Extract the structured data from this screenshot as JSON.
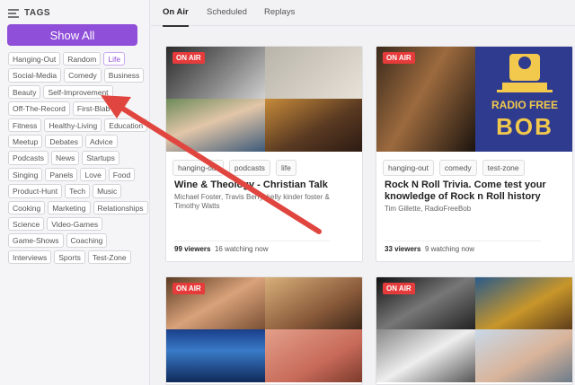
{
  "sidebar": {
    "header": "TAGS",
    "show_all": "Show All",
    "tags": [
      "Hanging-Out",
      "Random",
      "Life",
      "Social-Media",
      "Comedy",
      "Business",
      "Beauty",
      "Self-Improvement",
      "Off-The-Record",
      "First-Blab",
      "Fitness",
      "Healthy-Living",
      "Education",
      "Meetup",
      "Debates",
      "Advice",
      "Podcasts",
      "News",
      "Startups",
      "Singing",
      "Panels",
      "Love",
      "Food",
      "Product-Hunt",
      "Tech",
      "Music",
      "Cooking",
      "Marketing",
      "Relationships",
      "Science",
      "Video-Games",
      "Game-Shows",
      "Coaching",
      "Interviews",
      "Sports",
      "Test-Zone"
    ],
    "active_tag": "Life"
  },
  "tabs": [
    "On Air",
    "Scheduled",
    "Replays"
  ],
  "badge": "ON AIR",
  "cards": [
    {
      "chips": [
        "hanging-out",
        "podcasts",
        "life"
      ],
      "title": "Wine & Theology - Christian Talk",
      "desc": "Michael Foster, Travis Berry, kelly kinder foster & Timothy Watts",
      "viewers": "99 viewers",
      "watching": "16 watching now"
    },
    {
      "chips": [
        "hanging-out",
        "comedy",
        "test-zone"
      ],
      "title": "Rock N Roll Trivia. Come test your knowledge of Rock n Roll history",
      "desc": "Tim Gillette, RadioFreeBob",
      "viewers": "33 viewers",
      "watching": "9 watching now"
    }
  ],
  "radio_logo": {
    "line1": "RADIO FREE",
    "line2": "BOB"
  },
  "colors": {
    "accent": "#8f4fd9",
    "onair": "#e63b3b",
    "arrow": "#e0463f"
  }
}
